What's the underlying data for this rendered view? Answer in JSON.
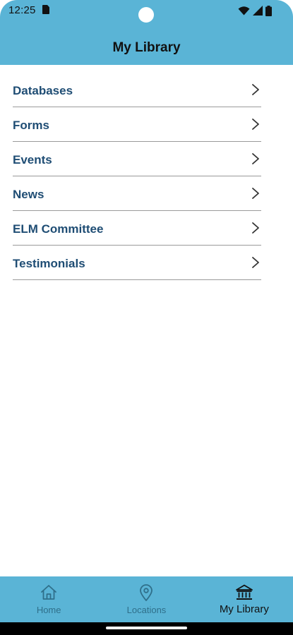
{
  "status_bar": {
    "time": "12:25",
    "icons": [
      "sim-card-icon",
      "wifi-icon",
      "signal-icon",
      "battery-icon"
    ]
  },
  "header": {
    "title": "My Library",
    "background": "#5ab4d6"
  },
  "menu": {
    "items": [
      {
        "label": "Databases"
      },
      {
        "label": "Forms"
      },
      {
        "label": "Events"
      },
      {
        "label": "News"
      },
      {
        "label": "ELM Committee"
      },
      {
        "label": "Testimonials"
      }
    ],
    "label_color": "#1f4d74",
    "chevron_icon": "chevron-right-icon"
  },
  "bottom_nav": {
    "items": [
      {
        "label": "Home",
        "icon": "home-icon",
        "active": false
      },
      {
        "label": "Locations",
        "icon": "location-pin-icon",
        "active": false
      },
      {
        "label": "My Library",
        "icon": "library-building-icon",
        "active": true
      }
    ],
    "background": "#5ab4d6"
  }
}
